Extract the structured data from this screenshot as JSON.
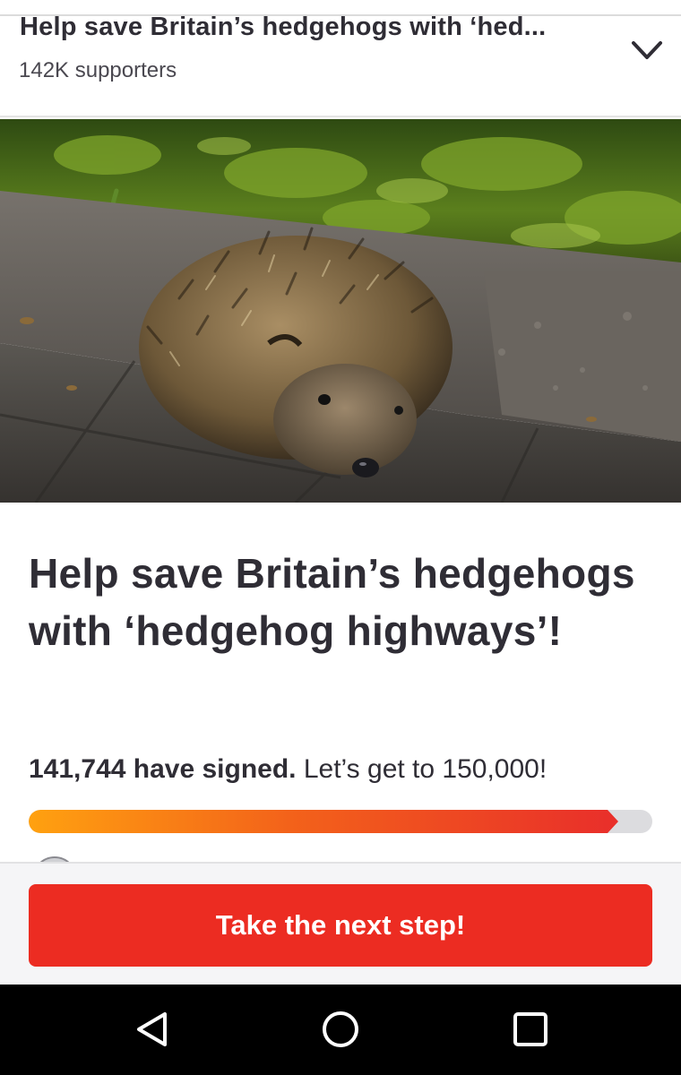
{
  "header": {
    "title": "Help save Britain’s hedgehogs with ‘hed...",
    "supporters": "142K supporters",
    "expand_icon": "chevron-down-icon"
  },
  "hero": {
    "image_description_icon": "hedgehog-photo"
  },
  "petition": {
    "title": "Help save Britain’s hedgehogs with ‘hedgehog highways’!",
    "signed_count": "141,744 have signed.",
    "goal_text": " Let’s get to 150,000!",
    "signatures": 141744,
    "goal": 150000,
    "progress_fraction": 0.945
  },
  "cta": {
    "label": "Take the next step!"
  },
  "navbar": {
    "back_icon": "back-triangle-icon",
    "home_icon": "home-circle-icon",
    "recents_icon": "recents-square-icon"
  },
  "colors": {
    "accent": "#ec2c22",
    "progress_start": "#ffa110",
    "progress_end": "#e9302a"
  }
}
